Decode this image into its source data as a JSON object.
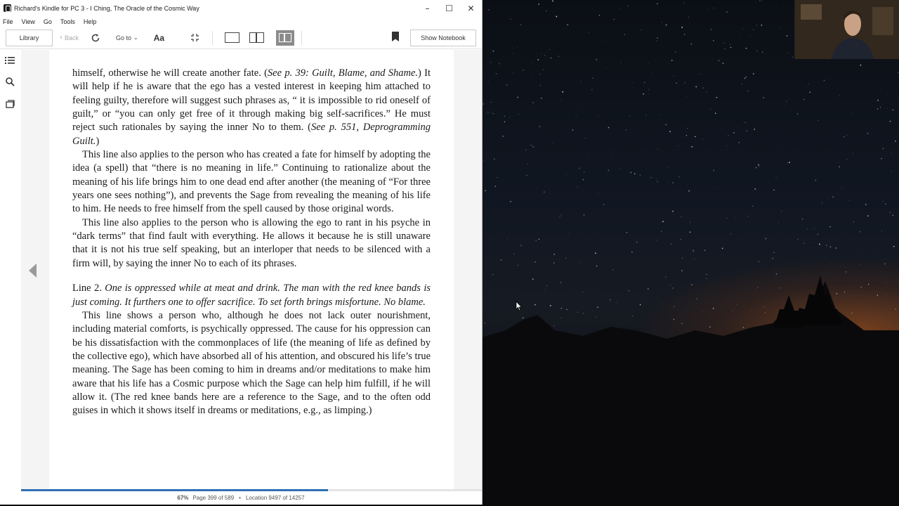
{
  "window": {
    "title": "Richard's Kindle for PC 3 - I Ching, The Oracle of the Cosmic Way",
    "controls": {
      "minimize": "–",
      "maximize": "☐",
      "close": "✕"
    }
  },
  "menu": [
    "File",
    "View",
    "Go",
    "Tools",
    "Help"
  ],
  "toolbar": {
    "library_label": "Library",
    "back_label": "Back",
    "goto_label": "Go to",
    "font_label": "Aa",
    "notebook_label": "Show Notebook"
  },
  "book": {
    "p1_a": "himself, otherwise he will create another fate. (",
    "p1_ref1": "See p. 39: Guilt, Blame, and Shame.",
    "p1_b": ") It will help if he is aware that the ego has a vested interest in keeping him attached to feeling guilty, therefore will suggest such phrases as, “ it is impossible to rid oneself of guilt,” or “you can only get free of it through making big self-sacrifices.” He must reject such rationales by saying the inner No to them. (",
    "p1_ref2": "See p. 551, Deprogramming Guilt.",
    "p1_c": ")",
    "p2": "This line also applies to the person who has created a fate for himself by adopting the idea (a spell) that “there is no meaning in life.” Continuing to rationalize about the meaning of his life brings him to one dead end after another (the meaning of “For three years one sees nothing”), and prevents the Sage from revealing the meaning of his life to him. He needs to free himself from the spell caused by those original words.",
    "p3": "This line also applies to the person who is allowing the ego to rant in his psyche in “dark terms” that find fault with everything. He allows it because he is still unaware that it is not his true self speaking, but an interloper that needs to be silenced with a firm will, by saying the inner No to each of its phrases.",
    "line2_label": "Line 2. ",
    "line2_text": "One is oppressed while at meat and drink. The man with the red knee bands is just coming. It furthers one to offer sacrifice. To set forth brings misfortune. No blame.",
    "p4": "This line shows a person who, although he does not lack outer nourishment, including material comforts, is psychically oppressed. The cause for his oppression can be his dissatisfaction with the commonplaces of life (the meaning of life as defined by the collective ego), which have absorbed all of his attention, and obscured his life’s true meaning. The Sage has been coming to him in dreams and/or meditations to make him aware that his life has a Cosmic purpose which the Sage can help him fulfill, if he will allow it. (The red knee bands here are a reference to the Sage, and to the often odd guises in which it shows itself in dreams or meditations, e.g., as limping.)"
  },
  "status": {
    "percent": "67%",
    "page": "Page 399 of 589",
    "location": "Location 9497 of 14257",
    "progress_fraction": 0.666
  },
  "colors": {
    "accent": "#2f6fb3",
    "page_bg": "#ffffff",
    "gutter": "#f4f4f4"
  }
}
